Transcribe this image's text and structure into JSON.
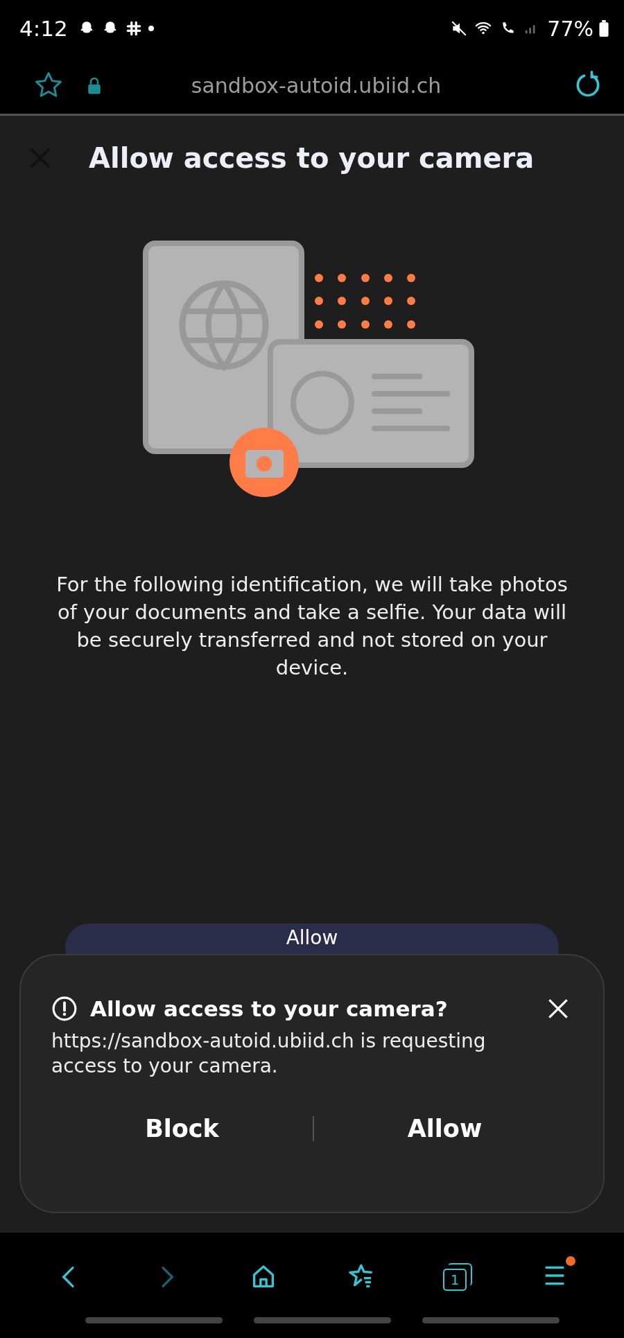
{
  "status_bar": {
    "time": "4:12",
    "battery": "77%"
  },
  "address_bar": {
    "url": "sandbox-autoid.ubiid.ch"
  },
  "page": {
    "title": "Allow access to your camera",
    "description": "For the following identification, we will take photos of your documents and take a selfie. Your data will be securely transferred and not stored on your device.",
    "primary_button": "Allow"
  },
  "permission_prompt": {
    "title": "Allow access to your camera?",
    "message": "https://sandbox-autoid.ubiid.ch is requesting access to your camera.",
    "buttons": [
      "Block",
      "Allow"
    ]
  },
  "bottom_nav": [
    {
      "kind": "back",
      "disabled": false
    },
    {
      "kind": "forward",
      "disabled": true
    },
    {
      "kind": "home",
      "disabled": false
    },
    {
      "kind": "bookmarks",
      "disabled": false
    },
    {
      "kind": "tabs",
      "disabled": false,
      "count": "1"
    },
    {
      "kind": "menu",
      "disabled": false,
      "badge": true
    }
  ]
}
